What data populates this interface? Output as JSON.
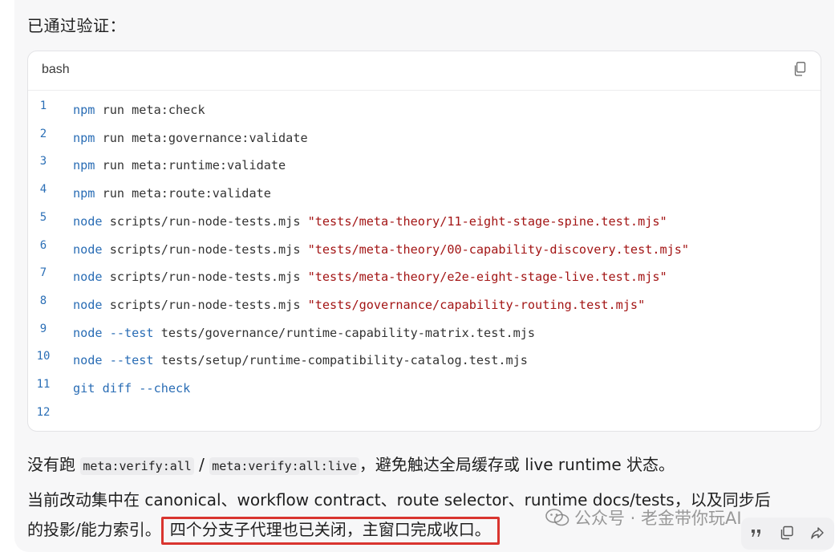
{
  "intro": "已通过验证：",
  "code_block": {
    "language": "bash",
    "lines": [
      {
        "num": "1",
        "parts": [
          {
            "t": "npm",
            "k": "kw"
          },
          {
            "t": " run meta:check",
            "k": ""
          }
        ]
      },
      {
        "num": "2",
        "parts": [
          {
            "t": "npm",
            "k": "kw"
          },
          {
            "t": " run meta:governance:validate",
            "k": ""
          }
        ]
      },
      {
        "num": "3",
        "parts": [
          {
            "t": "npm",
            "k": "kw"
          },
          {
            "t": " run meta:runtime:validate",
            "k": ""
          }
        ]
      },
      {
        "num": "4",
        "parts": [
          {
            "t": "npm",
            "k": "kw"
          },
          {
            "t": " run meta:route:validate",
            "k": ""
          }
        ]
      },
      {
        "num": "5",
        "parts": [
          {
            "t": "node",
            "k": "kw"
          },
          {
            "t": " scripts/run-node-tests.mjs ",
            "k": ""
          },
          {
            "t": "\"tests/meta-theory/11-eight-stage-spine.test.mjs\"",
            "k": "str"
          }
        ]
      },
      {
        "num": "6",
        "parts": [
          {
            "t": "node",
            "k": "kw"
          },
          {
            "t": " scripts/run-node-tests.mjs ",
            "k": ""
          },
          {
            "t": "\"tests/meta-theory/00-capability-discovery.test.mjs\"",
            "k": "str"
          }
        ]
      },
      {
        "num": "7",
        "parts": [
          {
            "t": "node",
            "k": "kw"
          },
          {
            "t": " scripts/run-node-tests.mjs ",
            "k": ""
          },
          {
            "t": "\"tests/meta-theory/e2e-eight-stage-live.test.mjs\"",
            "k": "str"
          }
        ]
      },
      {
        "num": "8",
        "parts": [
          {
            "t": "node",
            "k": "kw"
          },
          {
            "t": " scripts/run-node-tests.mjs ",
            "k": ""
          },
          {
            "t": "\"tests/governance/capability-routing.test.mjs\"",
            "k": "str"
          }
        ]
      },
      {
        "num": "9",
        "parts": [
          {
            "t": "node --test",
            "k": "kw"
          },
          {
            "t": " tests/governance/runtime-capability-matrix.test.mjs",
            "k": ""
          }
        ]
      },
      {
        "num": "10",
        "parts": [
          {
            "t": "node --test",
            "k": "kw"
          },
          {
            "t": " tests/setup/runtime-compatibility-catalog.test.mjs",
            "k": ""
          }
        ]
      },
      {
        "num": "11",
        "parts": [
          {
            "t": "git diff --check",
            "k": "kw"
          }
        ]
      },
      {
        "num": "12",
        "parts": []
      }
    ]
  },
  "para1": {
    "before": "没有跑 ",
    "code1": "meta:verify:all",
    "sep": " / ",
    "code2": "meta:verify:all:live",
    "after": "，避免触达全局缓存或 live runtime 状态。"
  },
  "para2": {
    "line1": "当前改动集中在 canonical、workflow contract、route selector、runtime docs/tests，以及同步后",
    "line2_before": "的投影/能力索引。",
    "line2_highlight": "四个分支子代理也已关闭，主窗口完成收口。"
  },
  "watermark": "公众号 · 老金带你玩AI",
  "icons": {
    "copy": "copy-icon",
    "quote": "quote-icon",
    "copy_message": "copy-message-icon",
    "share": "share-icon",
    "wechat": "wechat-logo-icon"
  },
  "colors": {
    "keyword": "#2a6db5",
    "string": "#a31515",
    "highlight_border": "#d9352f",
    "line_number": "#2b6fb6"
  }
}
